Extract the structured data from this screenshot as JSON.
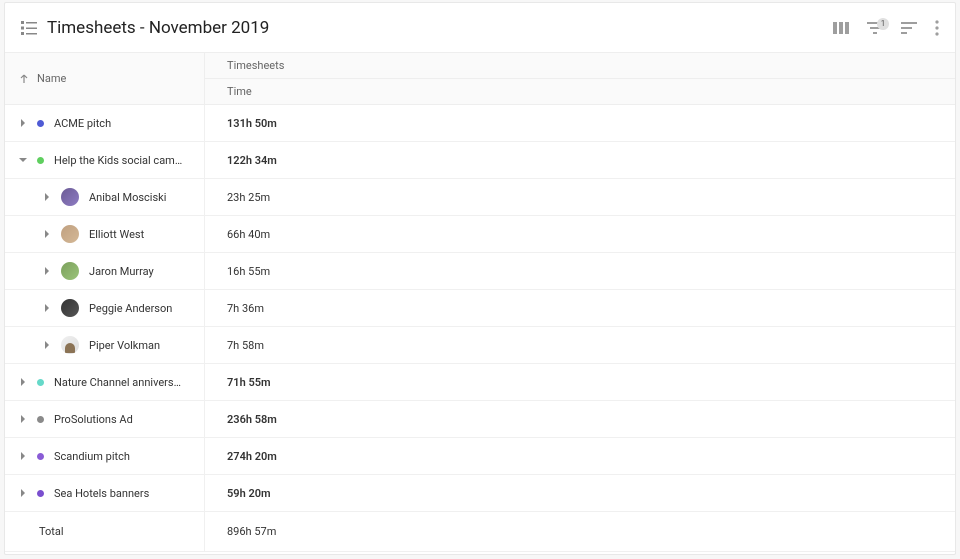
{
  "header": {
    "title": "Timesheets - November 2019"
  },
  "toolbar": {
    "filter_badge": "1"
  },
  "columns": {
    "name": "Name",
    "group": "Timesheets",
    "sub": "Time"
  },
  "projects": [
    {
      "name": "ACME pitch",
      "time": "131h 50m",
      "color": "#4f5bd5",
      "expanded": false
    },
    {
      "name": "Help the Kids social campaign",
      "time": "122h 34m",
      "color": "#5fcf5f",
      "expanded": true,
      "members": [
        {
          "name": "Anibal Mosciski",
          "time": "23h 25m",
          "avatar": "av-1"
        },
        {
          "name": "Elliott West",
          "time": "66h 40m",
          "avatar": "av-2"
        },
        {
          "name": "Jaron Murray",
          "time": "16h 55m",
          "avatar": "av-3"
        },
        {
          "name": "Peggie Anderson",
          "time": "7h 36m",
          "avatar": "av-4"
        },
        {
          "name": "Piper Volkman",
          "time": "7h 58m",
          "avatar": "av-5"
        }
      ]
    },
    {
      "name": "Nature Channel anniversary cam...",
      "time": "71h 55m",
      "color": "#66d9c9",
      "expanded": false
    },
    {
      "name": "ProSolutions Ad",
      "time": "236h 58m",
      "color": "#8a8a8a",
      "expanded": false
    },
    {
      "name": "Scandium pitch",
      "time": "274h 20m",
      "color": "#8a5cd6",
      "expanded": false
    },
    {
      "name": "Sea Hotels banners",
      "time": "59h 20m",
      "color": "#7a4fcf",
      "expanded": false
    }
  ],
  "total": {
    "label": "Total",
    "time": "896h 57m"
  }
}
